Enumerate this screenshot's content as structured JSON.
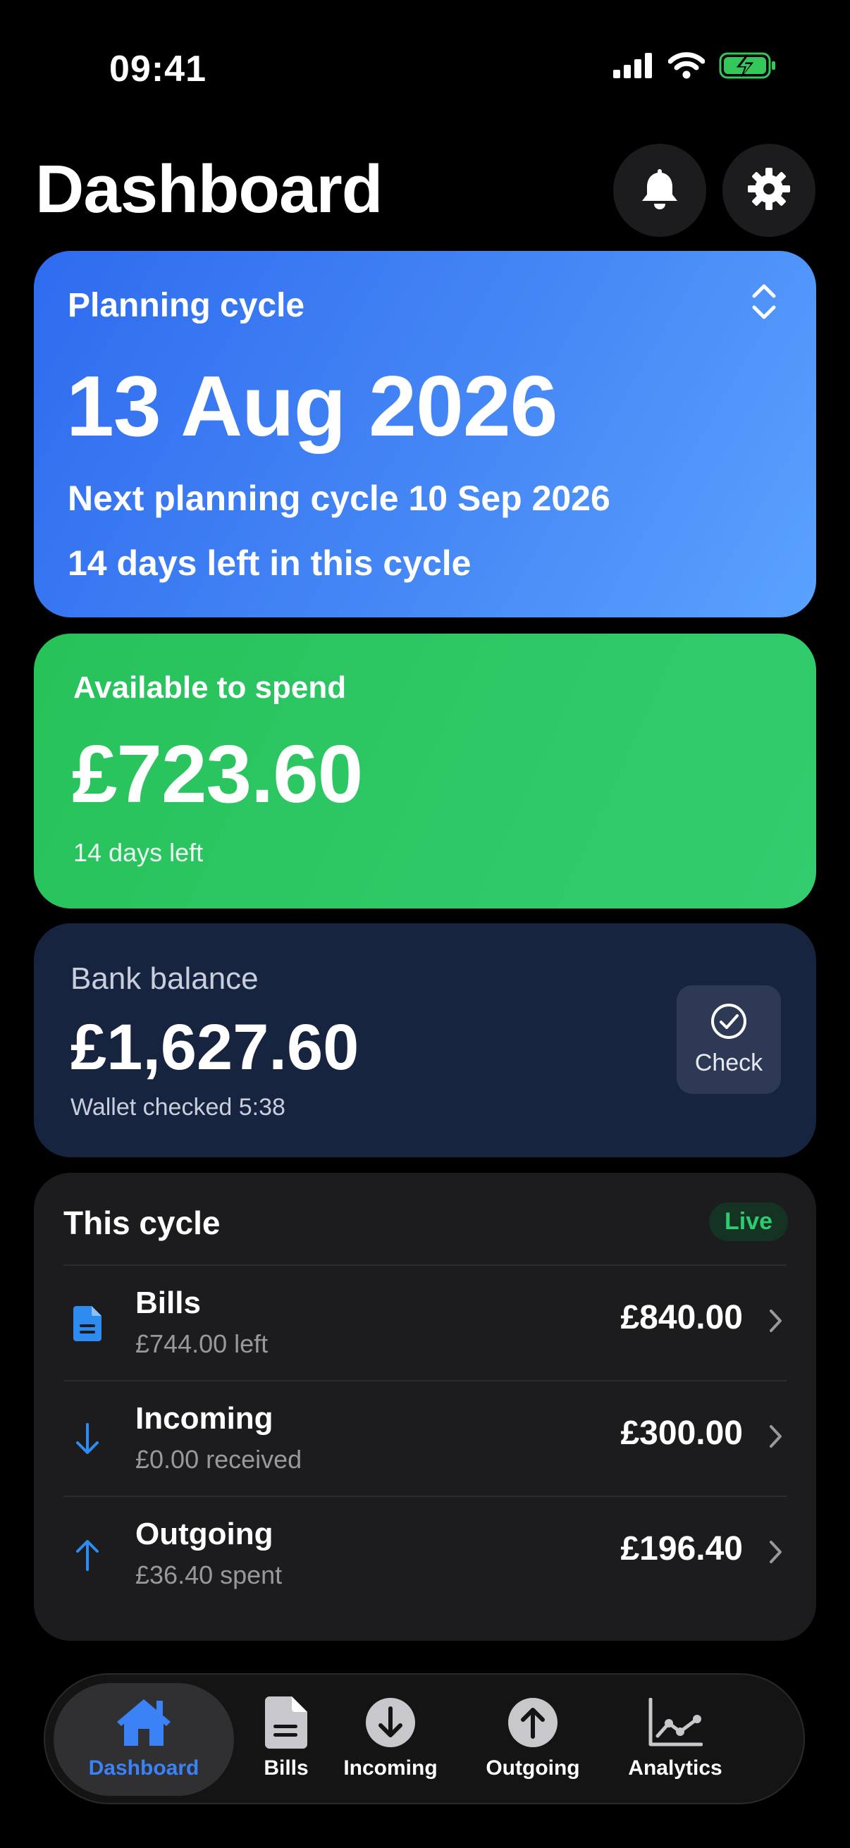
{
  "status_bar": {
    "time": "09:41"
  },
  "header": {
    "title": "Dashboard"
  },
  "planning": {
    "label": "Planning cycle",
    "date": "13 Aug 2026",
    "next": "Next planning cycle 10 Sep 2026",
    "days_left": "14 days left in this cycle"
  },
  "spend": {
    "label": "Available to spend",
    "amount": "£723.60",
    "days_left": "14 days left"
  },
  "bank": {
    "label": "Bank balance",
    "amount": "£1,627.60",
    "checked": "Wallet checked 5:38",
    "check_label": "Check"
  },
  "cycle": {
    "title": "This cycle",
    "badge": "Live",
    "rows": [
      {
        "title": "Bills",
        "sub": "£744.00 left",
        "amount": "£840.00",
        "icon": "document-icon"
      },
      {
        "title": "Incoming",
        "sub": "£0.00 received",
        "amount": "£300.00",
        "icon": "arrow-down-icon"
      },
      {
        "title": "Outgoing",
        "sub": "£36.40 spent",
        "amount": "£196.40",
        "icon": "arrow-up-icon"
      }
    ]
  },
  "tabs": [
    {
      "label": "Dashboard",
      "icon": "house-icon",
      "active": true
    },
    {
      "label": "Bills",
      "icon": "document-icon"
    },
    {
      "label": "Incoming",
      "icon": "arrow-down-circle-icon"
    },
    {
      "label": "Outgoing",
      "icon": "arrow-up-circle-icon"
    },
    {
      "label": "Analytics",
      "icon": "chart-line-icon"
    }
  ],
  "colors": {
    "accent_blue": "#3b82f6",
    "planning_card": "#4587f5",
    "spend_card": "#2ec866",
    "bank_card": "#172440",
    "live_green": "#2ecc71",
    "battery_green": "#34c759"
  }
}
